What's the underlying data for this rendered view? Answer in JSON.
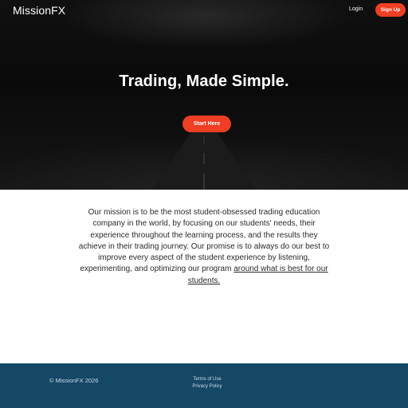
{
  "header": {
    "brand": "MissionFX",
    "login_label": "Login",
    "signup_label": "Sign Up"
  },
  "hero": {
    "title": "Trading, Made Simple.",
    "cta_label": "Start Here"
  },
  "mission": {
    "text": "Our mission is to be the most student-obsessed trading education company in the world, by focusing on our students' needs, their experience throughout the learning process, and the results they achieve in their trading journey. Our promise is to always do our best to improve every aspect of the student experience by listening, experimenting, and optimizing our program ",
    "link_text": "around what is best for our students."
  },
  "footer": {
    "copyright": "© MissionFX 2026",
    "links": [
      "Terms of Use",
      "Privacy Policy"
    ]
  },
  "colors": {
    "accent": "#ee3e24",
    "footer_bg": "#154767",
    "hero_bg": "#0c0c0c"
  }
}
